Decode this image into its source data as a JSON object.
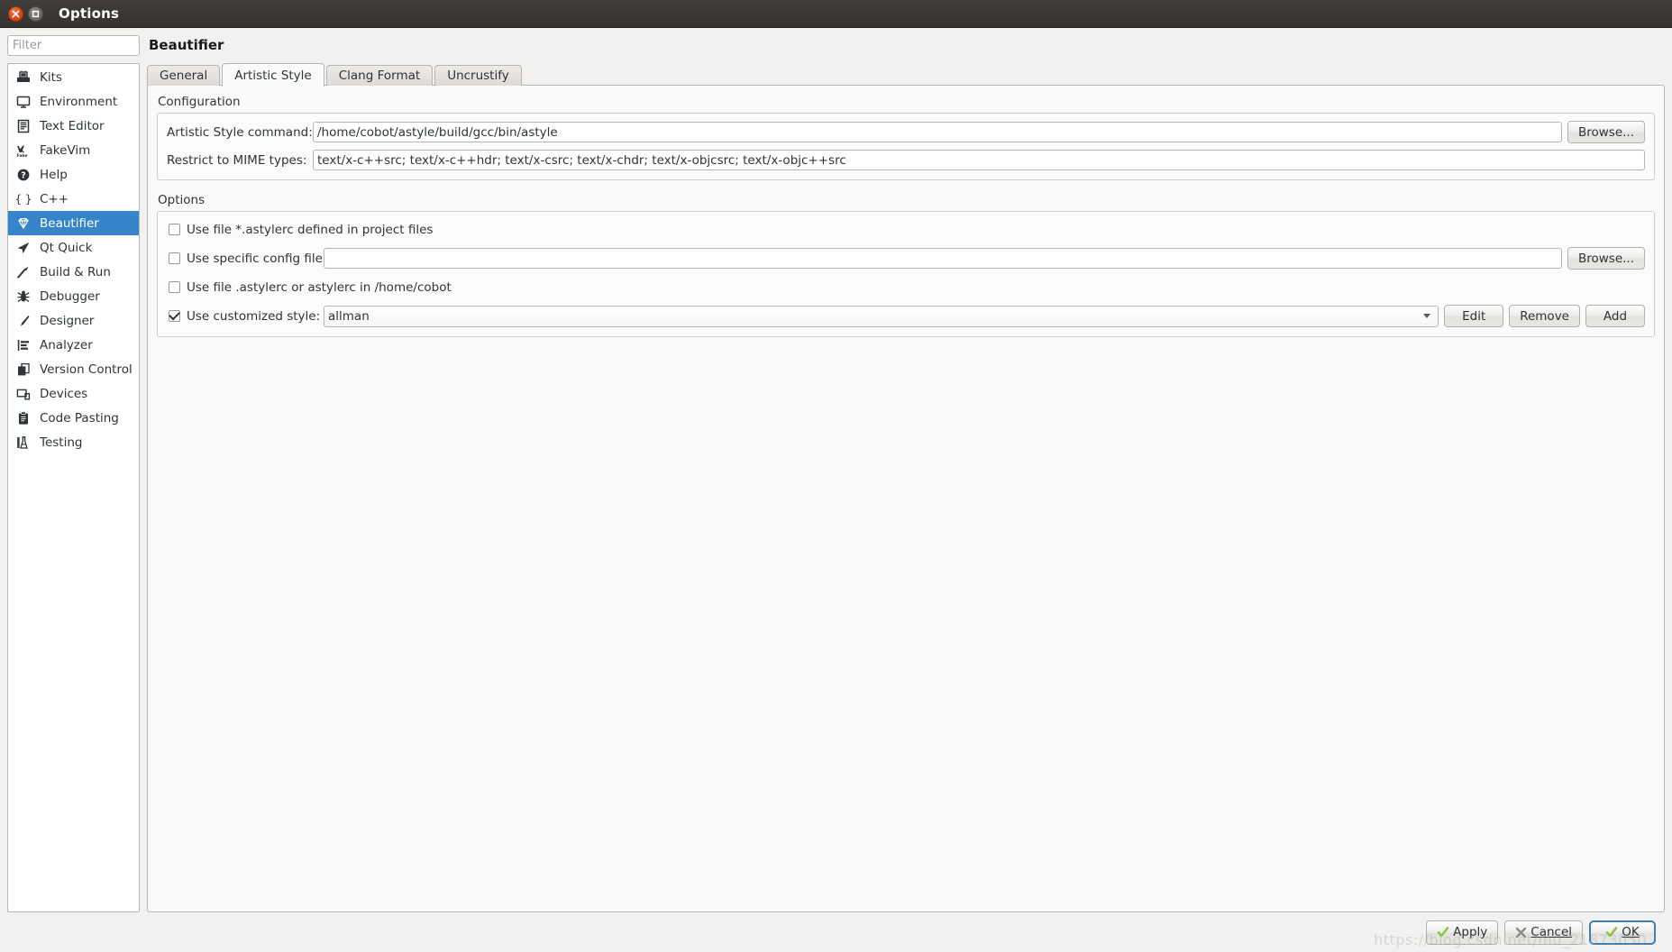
{
  "window": {
    "title": "Options",
    "close_icon": "close-icon",
    "maximize_icon": "maximize-icon"
  },
  "sidebar": {
    "filter_placeholder": "Filter",
    "filter_value": "",
    "items": [
      {
        "label": "Kits",
        "icon": "kit-icon",
        "selected": false
      },
      {
        "label": "Environment",
        "icon": "monitor-icon",
        "selected": false
      },
      {
        "label": "Text Editor",
        "icon": "document-lines-icon",
        "selected": false
      },
      {
        "label": "FakeVim",
        "icon": "fakevim-icon",
        "selected": false
      },
      {
        "label": "Help",
        "icon": "question-circle-icon",
        "selected": false
      },
      {
        "label": "C++",
        "icon": "braces-icon",
        "selected": false
      },
      {
        "label": "Beautifier",
        "icon": "diamond-icon",
        "selected": true
      },
      {
        "label": "Qt Quick",
        "icon": "paper-plane-icon",
        "selected": false
      },
      {
        "label": "Build & Run",
        "icon": "hammer-icon",
        "selected": false
      },
      {
        "label": "Debugger",
        "icon": "bug-icon",
        "selected": false
      },
      {
        "label": "Designer",
        "icon": "pencil-icon",
        "selected": false
      },
      {
        "label": "Analyzer",
        "icon": "analyzer-bars-icon",
        "selected": false
      },
      {
        "label": "Version Control",
        "icon": "copy-pages-icon",
        "selected": false
      },
      {
        "label": "Devices",
        "icon": "device-screen-icon",
        "selected": false
      },
      {
        "label": "Code Pasting",
        "icon": "clipboard-icon",
        "selected": false
      },
      {
        "label": "Testing",
        "icon": "flask-icon",
        "selected": false
      }
    ]
  },
  "main": {
    "page_title": "Beautifier",
    "tabs": [
      {
        "label": "General",
        "active": false
      },
      {
        "label": "Artistic Style",
        "active": true
      },
      {
        "label": "Clang Format",
        "active": false
      },
      {
        "label": "Uncrustify",
        "active": false
      }
    ],
    "configuration": {
      "group_label": "Configuration",
      "command_label": "Artistic Style command:",
      "command_value": "/home/cobot/astyle/build/gcc/bin/astyle",
      "command_browse_label": "Browse...",
      "mime_label": "Restrict to MIME types:",
      "mime_value": "text/x-c++src; text/x-c++hdr; text/x-csrc; text/x-chdr; text/x-objcsrc; text/x-objc++src"
    },
    "options": {
      "group_label": "Options",
      "use_project_astylerc": {
        "label": "Use file *.astylerc defined in project files",
        "checked": false
      },
      "use_specific_config": {
        "label": "Use specific config file:",
        "checked": false,
        "value": "",
        "browse_label": "Browse..."
      },
      "use_home_astylerc": {
        "label": "Use file .astylerc or astylerc in /home/cobot",
        "checked": false
      },
      "use_customized_style": {
        "label": "Use customized style:",
        "checked": true,
        "selected_style": "allman",
        "edit_label": "Edit",
        "remove_label": "Remove",
        "add_label": "Add"
      }
    }
  },
  "footer": {
    "apply_label": "Apply",
    "cancel_label": "Cancel",
    "ok_label": "OK",
    "apply_icon": "check-icon",
    "cancel_icon": "x-mark-icon",
    "ok_icon": "check-icon",
    "watermark": "https://blog.csdn.net/m0_21873050"
  },
  "colors": {
    "accent": "#3584cc",
    "titlebar": "#3a3735",
    "close_button": "#dd4814",
    "check_green": "#8ec641"
  }
}
